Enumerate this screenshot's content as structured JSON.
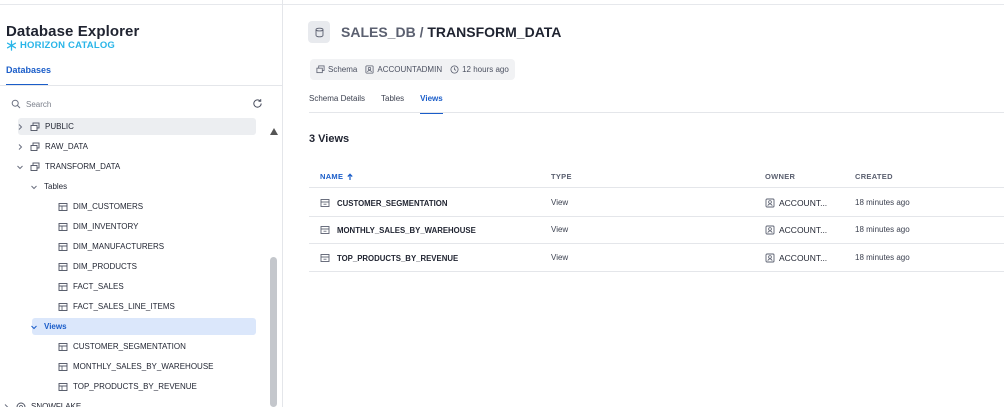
{
  "sidebar": {
    "title": "Database Explorer",
    "catalog": "HORIZON CATALOG",
    "tab": "Databases",
    "search_placeholder": "Search",
    "tree": [
      {
        "label": "PUBLIC",
        "level": 1,
        "state": "hover"
      },
      {
        "label": "RAW_DATA",
        "level": 1
      },
      {
        "label": "TRANSFORM_DATA",
        "level": 1,
        "expanded": true
      },
      {
        "label": "Tables",
        "level": 2,
        "expanded": true
      },
      {
        "label": "DIM_CUSTOMERS",
        "level": 3
      },
      {
        "label": "DIM_INVENTORY",
        "level": 3
      },
      {
        "label": "DIM_MANUFACTURERS",
        "level": 3
      },
      {
        "label": "DIM_PRODUCTS",
        "level": 3
      },
      {
        "label": "FACT_SALES",
        "level": 3
      },
      {
        "label": "FACT_SALES_LINE_ITEMS",
        "level": 3
      },
      {
        "label": "Views",
        "level": 2,
        "expanded": true,
        "state": "selected"
      },
      {
        "label": "CUSTOMER_SEGMENTATION",
        "level": 3
      },
      {
        "label": "MONTHLY_SALES_BY_WAREHOUSE",
        "level": 3
      },
      {
        "label": "TOP_PRODUCTS_BY_REVENUE",
        "level": 3
      },
      {
        "label": "SNOWFLAKE",
        "level": 0
      }
    ]
  },
  "header": {
    "db": "SALES_DB",
    "separator": " / ",
    "schema": "TRANSFORM_DATA"
  },
  "meta": {
    "type": "Schema",
    "owner": "ACCOUNTADMIN",
    "age": "12 hours ago"
  },
  "tabs": [
    "Schema Details",
    "Tables",
    "Views"
  ],
  "active_tab": "Views",
  "views_count": "3 Views",
  "table": {
    "headers": {
      "name": "NAME",
      "type": "TYPE",
      "owner": "OWNER",
      "created": "CREATED"
    },
    "rows": [
      {
        "name": "CUSTOMER_SEGMENTATION",
        "type": "View",
        "owner": "ACCOUNT...",
        "created": "18 minutes ago"
      },
      {
        "name": "MONTHLY_SALES_BY_WAREHOUSE",
        "type": "View",
        "owner": "ACCOUNT...",
        "created": "18 minutes ago"
      },
      {
        "name": "TOP_PRODUCTS_BY_REVENUE",
        "type": "View",
        "owner": "ACCOUNT...",
        "created": "18 minutes ago"
      }
    ]
  },
  "colors": {
    "accent": "#1a5dc9",
    "catalog": "#29b5e8"
  }
}
